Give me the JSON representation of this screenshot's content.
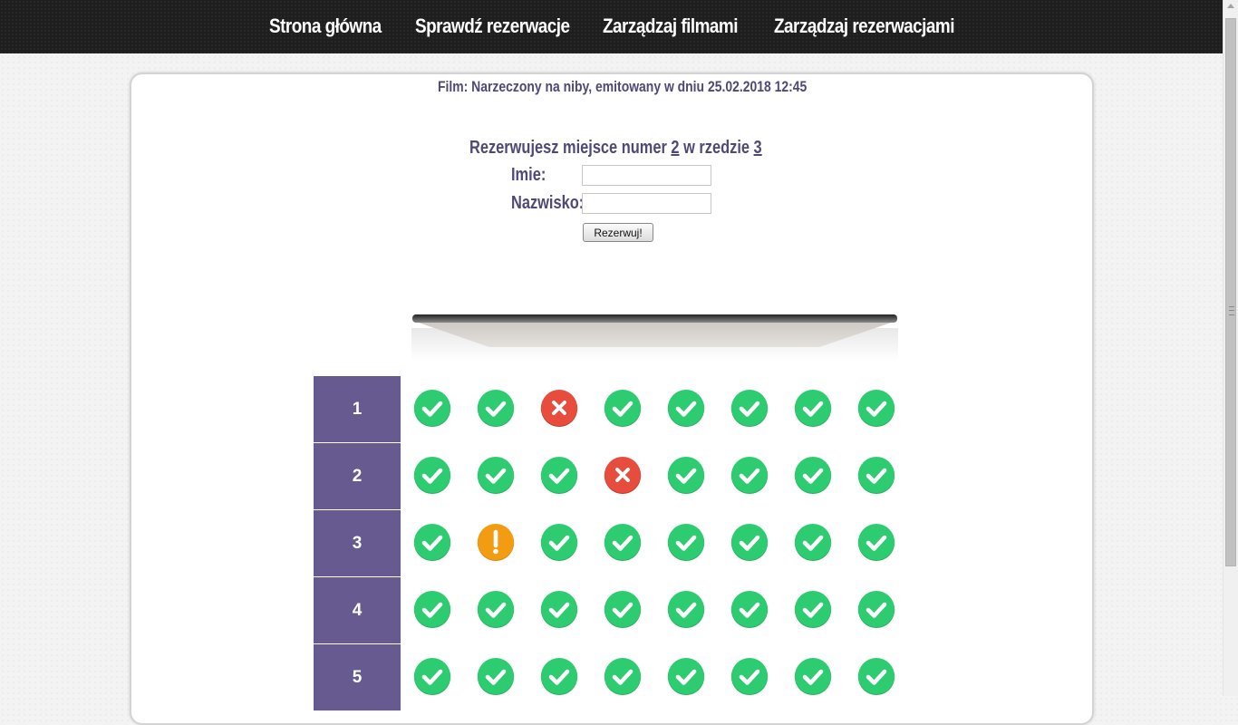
{
  "nav": {
    "items": [
      "Strona główna",
      "Sprawdź rezerwacje",
      "Zarządzaj filmami",
      "Zarządzaj rezerwacjami"
    ]
  },
  "film_info": "Film: Narzeczony na niby, emitowany w dniu 25.02.2018 12:45",
  "reservation": {
    "text_before": "Rezerwujesz miejsce numer ",
    "seat_number": "2",
    "text_middle": " w rzedzie ",
    "row_number": "3",
    "first_name_label": "Imie:",
    "last_name_label": "Nazwisko:",
    "first_name_value": "",
    "last_name_value": "",
    "submit_label": "Rezerwuj!"
  },
  "colors": {
    "available": "#2ecc71",
    "taken": "#e74c3c",
    "selected": "#f39c12",
    "row_label_bg": "#665a90",
    "text_accent": "#4f4978"
  },
  "seat_status_icons": {
    "available": "check-icon",
    "taken": "cross-icon",
    "selected": "exclamation-icon"
  },
  "seating": {
    "rows": [
      {
        "label": "1",
        "seats": [
          "available",
          "available",
          "taken",
          "available",
          "available",
          "available",
          "available",
          "available"
        ]
      },
      {
        "label": "2",
        "seats": [
          "available",
          "available",
          "available",
          "taken",
          "available",
          "available",
          "available",
          "available"
        ]
      },
      {
        "label": "3",
        "seats": [
          "available",
          "selected",
          "available",
          "available",
          "available",
          "available",
          "available",
          "available"
        ]
      },
      {
        "label": "4",
        "seats": [
          "available",
          "available",
          "available",
          "available",
          "available",
          "available",
          "available",
          "available"
        ]
      },
      {
        "label": "5",
        "seats": [
          "available",
          "available",
          "available",
          "available",
          "available",
          "available",
          "available",
          "available"
        ]
      }
    ]
  }
}
